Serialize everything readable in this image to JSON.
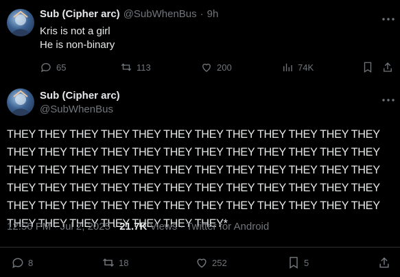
{
  "reply_tweet": {
    "display_name": "Sub (Cipher arc)",
    "handle": "@SubWhenBus",
    "separator": "·",
    "time": "9h",
    "lines": [
      "Kris is not a girl",
      "He is non-binary"
    ],
    "replies": "65",
    "reposts": "113",
    "likes": "200",
    "views": "74K"
  },
  "main_tweet": {
    "display_name": "Sub (Cipher arc)",
    "handle": "@SubWhenBus",
    "text": "THEY THEY THEY THEY THEY THEY THEY THEY THEY THEY THEY THEY THEY THEY THEY THEY THEY THEY THEY THEY THEY THEY THEY THEY THEY THEY THEY THEY THEY THEY THEY THEY THEY THEY THEY THEY THEY THEY THEY THEY THEY THEY THEY THEY THEY THEY THEY THEY THEY THEY THEY THEY THEY THEY THEY THEY THEY THEY THEY THEY THEY THEY THEY THEY THEY THEY THEY*",
    "time": "12:56 PM",
    "date": "Jul 2, 2025",
    "views_count": "21.7K",
    "views_label": "Views",
    "source": "Twitter for Android",
    "replies": "8",
    "reposts": "18",
    "likes": "252",
    "bookmarks": "5"
  },
  "icons": [
    "avatar",
    "reply-icon",
    "repost-icon",
    "like-icon",
    "views-icon",
    "bookmark-icon",
    "share-icon"
  ]
}
